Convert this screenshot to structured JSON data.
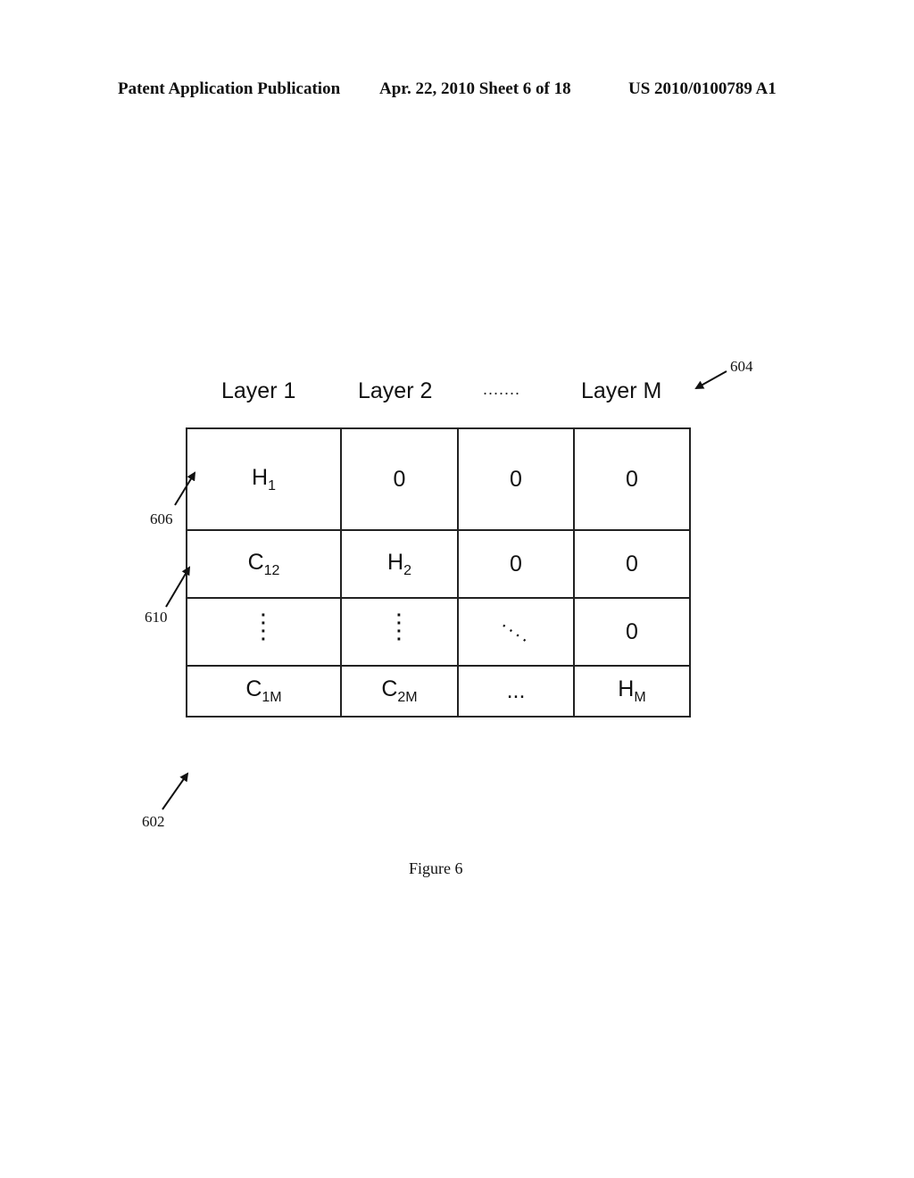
{
  "header": {
    "publication": "Patent Application Publication",
    "date_sheet": "Apr. 22, 2010  Sheet 6 of 18",
    "number": "US 2010/0100789 A1"
  },
  "figure": {
    "columns": [
      "Layer 1",
      "Layer 2",
      "Layer M"
    ],
    "column_ellipsis": ".......",
    "matrix": [
      [
        {
          "main": "H",
          "sub": "1"
        },
        {
          "main": "0",
          "sub": ""
        },
        {
          "main": "0",
          "sub": ""
        },
        {
          "main": "0",
          "sub": ""
        }
      ],
      [
        {
          "main": "C",
          "sub": "12"
        },
        {
          "main": "H",
          "sub": "2"
        },
        {
          "main": "0",
          "sub": ""
        },
        {
          "main": "0",
          "sub": ""
        }
      ],
      [
        {
          "main": "vertical-dots",
          "sub": ""
        },
        {
          "main": "vertical-dots",
          "sub": ""
        },
        {
          "main": "diagonal-dots",
          "sub": ""
        },
        {
          "main": "0",
          "sub": ""
        }
      ],
      [
        {
          "main": "C",
          "sub": "1M"
        },
        {
          "main": "C",
          "sub": "2M"
        },
        {
          "main": "...",
          "sub": ""
        },
        {
          "main": "H",
          "sub": "M"
        }
      ]
    ],
    "reference_labels": {
      "r602": "602",
      "r604": "604",
      "r606": "606",
      "r610": "610"
    },
    "caption": "Figure 6"
  }
}
